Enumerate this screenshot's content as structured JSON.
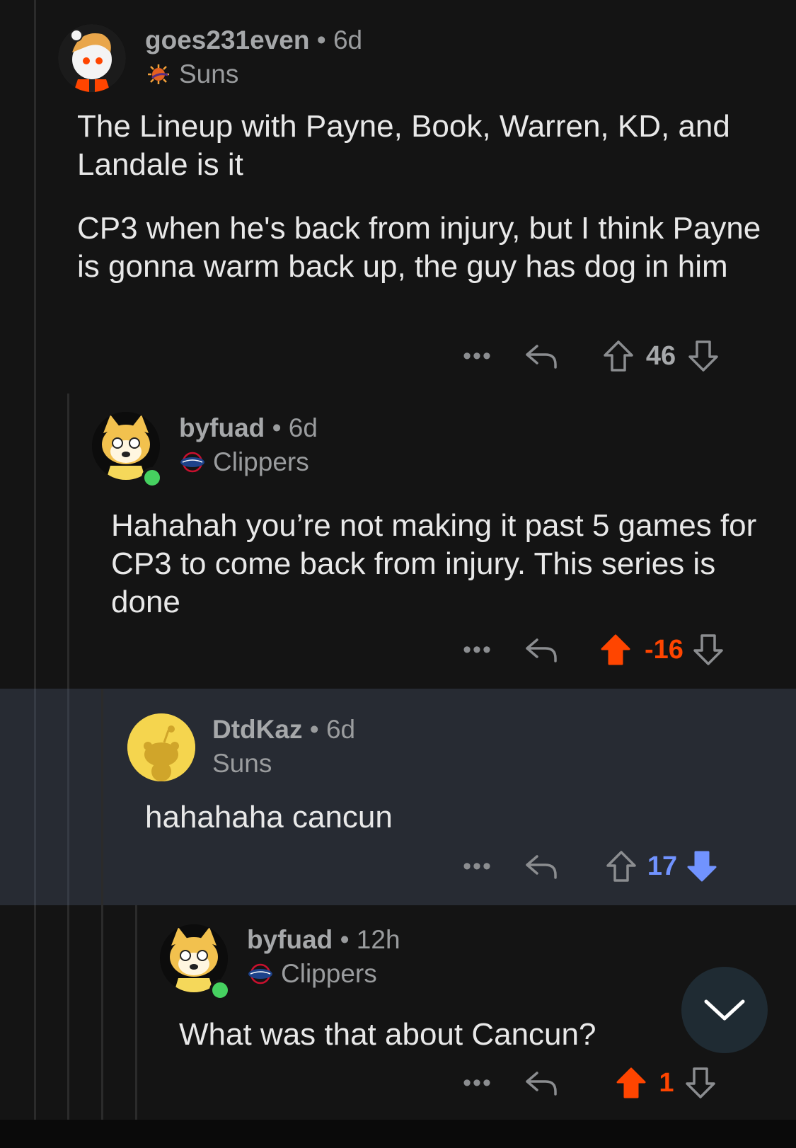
{
  "colors": {
    "background": "#141414",
    "highlight": "#272b33",
    "upvote_active": "#ff4500",
    "downvote_active": "#7193ff",
    "online": "#46d160"
  },
  "comments": [
    {
      "username": "goes231even",
      "age": "6d",
      "flair": "Suns",
      "flair_icon": "suns-logo-icon",
      "avatar": "snoo-avatar",
      "body": [
        "The Lineup with Payne, Book, Warren, KD, and Landale is it",
        "CP3 when he's back from injury, but I think Payne is gonna warm back up, the guy has dog in him"
      ],
      "score": "46",
      "vote_state": "none"
    },
    {
      "username": "byfuad",
      "age": "6d",
      "flair": "Clippers",
      "flair_icon": "clippers-logo-icon",
      "avatar": "shiba-avatar",
      "online": true,
      "body": [
        "Hahahah you’re not making it past 5 games for CP3 to come back from injury. This series is done"
      ],
      "score": "-16",
      "vote_state": "upvoted"
    },
    {
      "username": "DtdKaz",
      "age": "6d",
      "flair": "Suns",
      "avatar": "default-snoo-avatar",
      "body": [
        "hahahaha cancun"
      ],
      "score": "17",
      "vote_state": "downvoted"
    },
    {
      "username": "byfuad",
      "age": "12h",
      "flair": "Clippers",
      "flair_icon": "clippers-logo-icon",
      "avatar": "shiba-avatar",
      "online": true,
      "body": [
        "What was that about Cancun?"
      ],
      "score": "1",
      "vote_state": "upvoted"
    }
  ],
  "action_labels": {
    "more": "•••"
  },
  "fab_icon": "chevron-down-icon"
}
